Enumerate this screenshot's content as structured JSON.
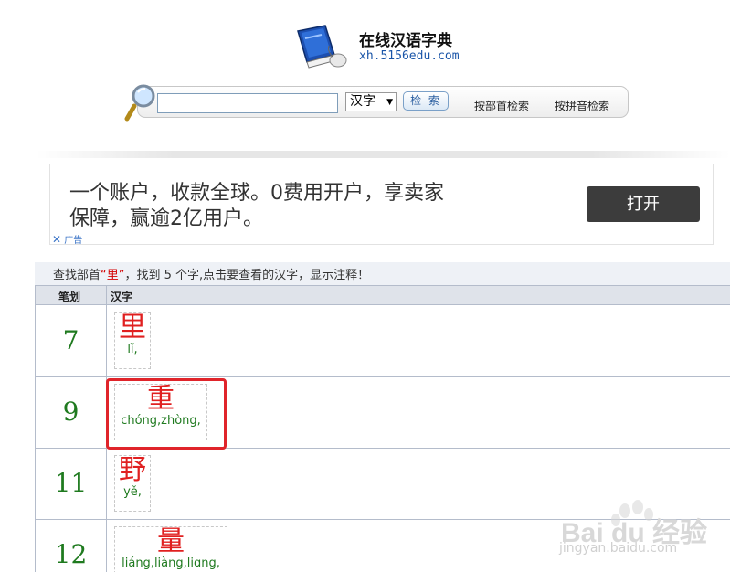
{
  "header": {
    "site_title": "在线汉语字典",
    "site_url": "xh.5156edu.com"
  },
  "search": {
    "input_value": "",
    "select_value": "汉字",
    "button_label": "检 索",
    "link_radical": "按部首检索",
    "link_pinyin": "按拼音检索"
  },
  "ad": {
    "line1": "一个账户，收款全球。0费用开户，享卖家",
    "line2": "保障，赢逾2亿用户。",
    "button_label": "打开",
    "close_mark": "✕",
    "ad_label": "广告"
  },
  "results": {
    "info_prefix": "查找部首",
    "radical": "“里”",
    "info_suffix": "，找到 5 个字,点击要查看的汉字，显示注释！",
    "col_strokes": "笔划",
    "col_chars": "汉字",
    "rows": [
      {
        "strokes": "7",
        "chars": [
          {
            "char": "里",
            "pinyin": "lǐ,"
          }
        ]
      },
      {
        "strokes": "9",
        "chars": [
          {
            "char": "重",
            "pinyin": "chóng,zhòng,"
          }
        ]
      },
      {
        "strokes": "11",
        "chars": [
          {
            "char": "野",
            "pinyin": "yě,"
          }
        ]
      },
      {
        "strokes": "12",
        "chars": [
          {
            "char": "量",
            "pinyin": "liáng,liàng,liɑng,"
          }
        ]
      }
    ]
  },
  "watermark": {
    "brand": "Bai du 经验",
    "url": "jingyan.baidu.com"
  },
  "colors": {
    "char_red": "#e02020",
    "pinyin_green": "#1f7a1f",
    "highlight_red": "#e0242a",
    "link_blue": "#1a55a8"
  },
  "icons": {
    "logo": "book-mouse-icon",
    "search": "magnifier-icon",
    "ad_close": "close-icon"
  }
}
